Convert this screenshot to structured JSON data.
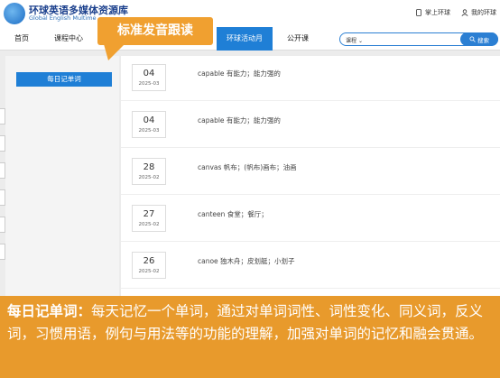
{
  "header": {
    "site_title": "环球英语多媒体资源库",
    "site_subtitle": "Global English Multime",
    "login_label": "掌上环球",
    "my_label": "我的环球"
  },
  "nav": {
    "items": [
      "首页",
      "课程中心",
      "环球活动月",
      "公开课"
    ],
    "active": "环球活动月"
  },
  "search": {
    "select_label": "课程",
    "button_label": "搜索"
  },
  "callout": {
    "text": "标准发音跟读"
  },
  "sidebar": {
    "active_item": "每日记单词"
  },
  "entries": [
    {
      "day": "04",
      "ym": "2025-03",
      "word": "capable 有能力；能力强的"
    },
    {
      "day": "04",
      "ym": "2025-03",
      "word": "capable 有能力；能力强的"
    },
    {
      "day": "28",
      "ym": "2025-02",
      "word": "canvas 帆布；(帆布)画布；油画"
    },
    {
      "day": "27",
      "ym": "2025-02",
      "word": "canteen 食堂；餐厅；"
    },
    {
      "day": "26",
      "ym": "2025-02",
      "word": "canoe 独木舟；皮划艇；小划子"
    }
  ],
  "bottom_note": {
    "label": "每日记单词：",
    "text": "每天记忆一个单词，通过对单词词性、词性变化、同义词，反义词，习惯用语，例句与用法等的功能的理解，加强对单词的记忆和融会贯通。"
  },
  "colors": {
    "primary": "#1f7fd6",
    "accent": "#e89a2c"
  }
}
